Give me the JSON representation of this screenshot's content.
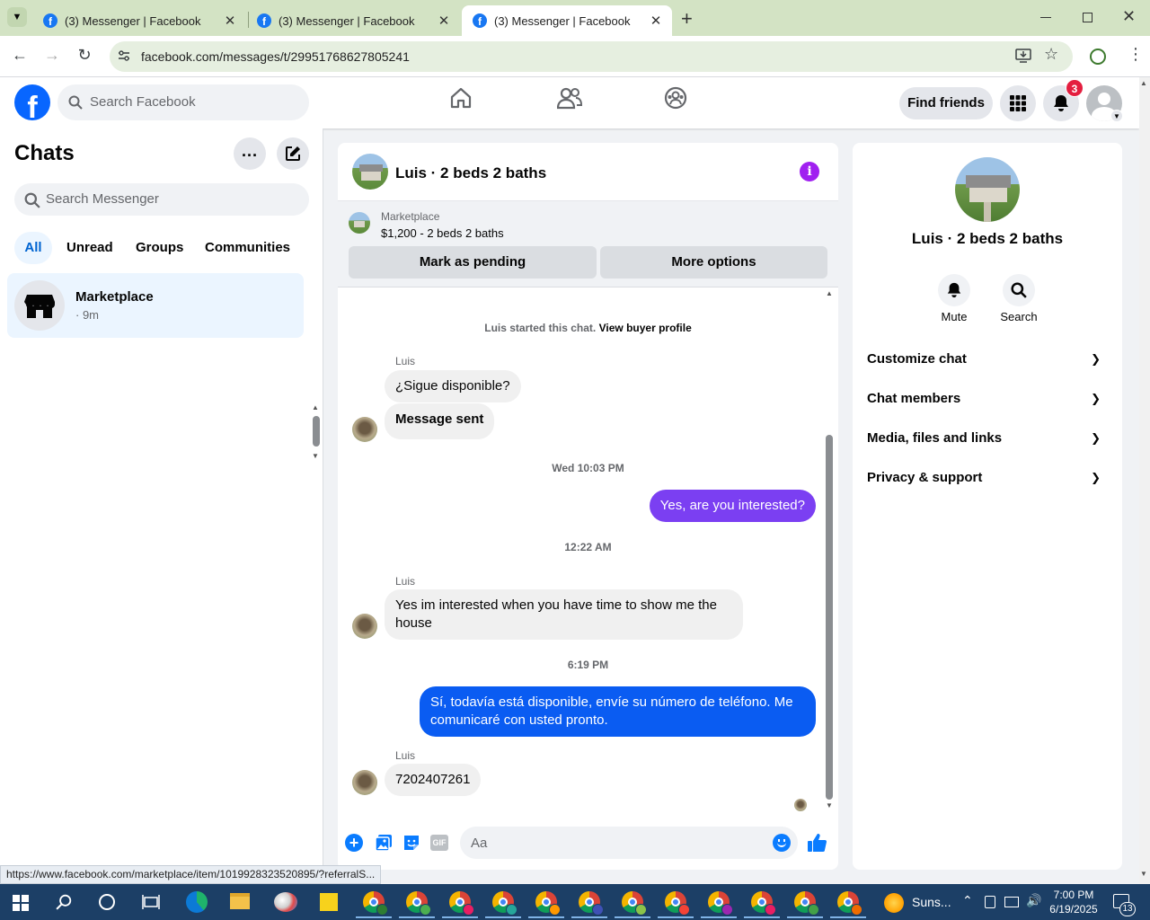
{
  "browser": {
    "tabs": [
      {
        "title": "(3) Messenger | Facebook",
        "active": false
      },
      {
        "title": "(3) Messenger | Facebook",
        "active": false
      },
      {
        "title": "(3) Messenger | Facebook",
        "active": true
      }
    ],
    "url": "facebook.com/messages/t/29951768627805241",
    "status_link": "https://www.facebook.com/marketplace/item/1019928323520895/?referralS..."
  },
  "fb_nav": {
    "search_placeholder": "Search Facebook",
    "find_friends": "Find friends",
    "notification_count": "3"
  },
  "chats": {
    "title": "Chats",
    "search_placeholder": "Search Messenger",
    "filters": [
      "All",
      "Unread",
      "Groups",
      "Communities"
    ],
    "active_filter": "All",
    "items": [
      {
        "name": "Marketplace",
        "time": "· 9m"
      }
    ]
  },
  "conversation": {
    "title": "Luis · 2 beds 2 baths",
    "marketplace_label": "Marketplace",
    "listing": "$1,200 - 2 beds 2 baths",
    "mark_pending": "Mark as pending",
    "more_options": "More options",
    "started_text": "Luis started this chat.",
    "view_profile": "View buyer profile",
    "messages": {
      "m1_sender": "Luis",
      "m1": "¿Sigue disponible?",
      "m2": "Message sent",
      "ts1": "Wed 10:03 PM",
      "m3": "Yes, are you interested?",
      "ts2": "12:22 AM",
      "m4_sender": "Luis",
      "m4": "Yes im interested when you have time to show me the house",
      "ts3": "6:19 PM",
      "m5": "Sí, todavía está disponible, envíe su número de teléfono. Me comunicaré con usted pronto.",
      "m6_sender": "Luis",
      "m6": "7202407261"
    },
    "composer_placeholder": "Aa",
    "colors": {
      "purple": "#7b3ff2",
      "blue": "#0a5cf2",
      "icon_blue": "#0a7cff",
      "info_purple": "#a020f0"
    }
  },
  "info_panel": {
    "name": "Luis · 2 beds 2 baths",
    "mute": "Mute",
    "search": "Search",
    "sections": [
      "Customize chat",
      "Chat members",
      "Media, files and links",
      "Privacy & support"
    ]
  },
  "taskbar": {
    "weather": "Suns...",
    "time": "7:00 PM",
    "date": "6/19/2025",
    "notifications": "13"
  }
}
